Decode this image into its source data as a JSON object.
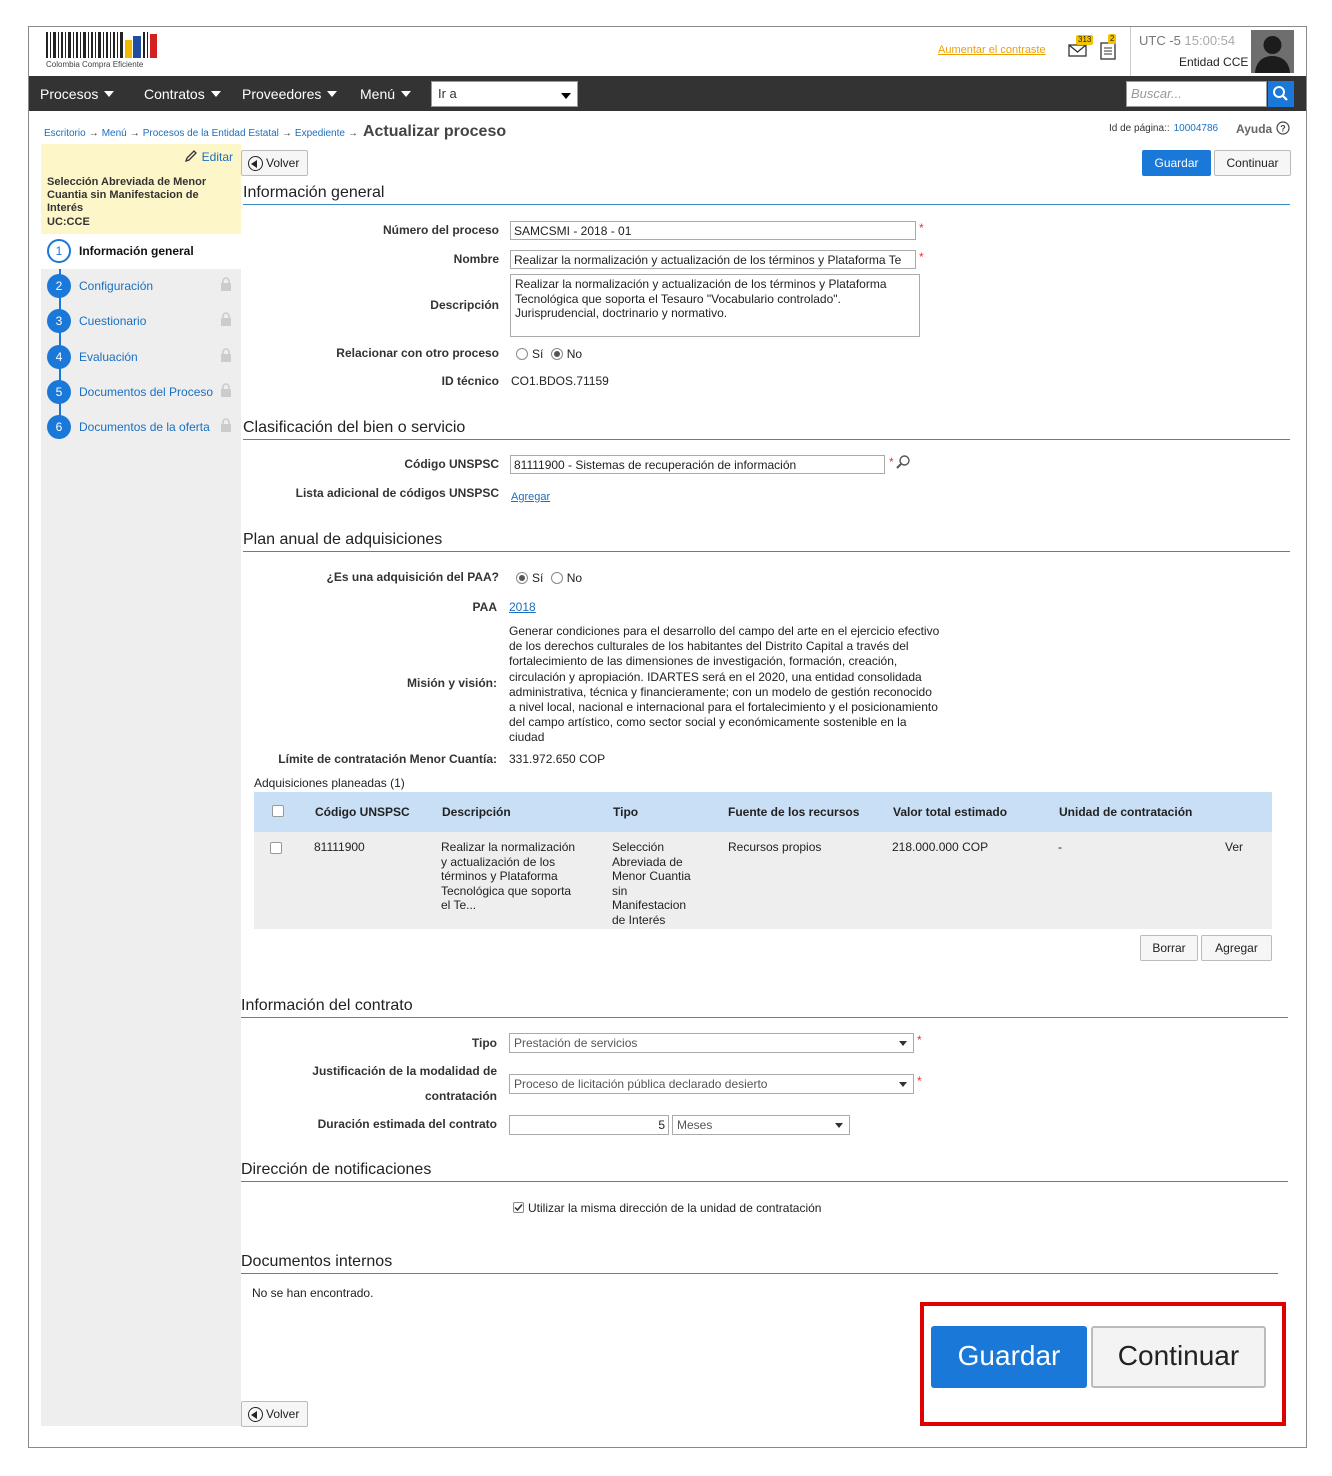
{
  "header": {
    "logo_text": "Colombia Compra Eficiente",
    "contrast_link": "Aumentar el contraste",
    "mail_count": "313",
    "notes_count": "2",
    "timezone": "UTC -5",
    "time": "15:00:54",
    "entity": "Entidad CCE"
  },
  "nav": {
    "items": [
      {
        "label": "Procesos"
      },
      {
        "label": "Contratos"
      },
      {
        "label": "Proveedores"
      },
      {
        "label": "Menú"
      }
    ],
    "goto": "Ir a",
    "search_placeholder": "Buscar..."
  },
  "breadcrumb": {
    "items": [
      "Escritorio",
      "Menú",
      "Procesos de la Entidad Estatal",
      "Expediente"
    ],
    "current": "Actualizar proceso",
    "arrow": "→"
  },
  "page_id": {
    "label": "Id de página::",
    "value": "10004786",
    "help": "Ayuda"
  },
  "sidebar": {
    "edit": "Editar",
    "process_type": "Selección Abreviada de Menor Cuantia sin Manifestacion de Interés",
    "uc": "UC:CCE",
    "steps": [
      {
        "num": "1",
        "label": "Información general"
      },
      {
        "num": "2",
        "label": "Configuración"
      },
      {
        "num": "3",
        "label": "Cuestionario"
      },
      {
        "num": "4",
        "label": "Evaluación"
      },
      {
        "num": "5",
        "label": "Documentos del Proceso"
      },
      {
        "num": "6",
        "label": "Documentos de la oferta"
      }
    ]
  },
  "buttons": {
    "back": "Volver",
    "save": "Guardar",
    "continue": "Continuar",
    "delete": "Borrar",
    "add": "Agregar"
  },
  "general": {
    "title": "Información general",
    "process_number_label": "Número del proceso",
    "process_number": "SAMCSMI - 2018 - 01",
    "name_label": "Nombre",
    "name": "Realizar la normalización y actualización de los términos y Plataforma Te",
    "description_label": "Descripción",
    "description": "Realizar la normalización y actualización de los términos y Plataforma Tecnológica que soporta el Tesauro \"Vocabulario controlado\". Jurisprudencial, doctrinario y normativo.",
    "relate_label": "Relacionar con otro proceso",
    "yes": "Sí",
    "no": "No",
    "tech_id_label": "ID técnico",
    "tech_id": "CO1.BDOS.71159",
    "required": "*"
  },
  "classification": {
    "title": "Clasificación del bien o servicio",
    "code_label": "Código UNSPSC",
    "code": "81111900 - Sistemas de recuperación de información",
    "extra_label": "Lista adicional de códigos UNSPSC",
    "add_link": "Agregar"
  },
  "paa": {
    "title": "Plan anual de adquisiciones",
    "question": "¿Es una adquisición del PAA?",
    "paa_label": "PAA",
    "paa_year": "2018",
    "mission_label": "Misión y visión:",
    "mission_lines": [
      "Generar condiciones para el desarrollo del campo del arte en el ejercicio efectivo",
      "de los derechos culturales de los habitantes del Distrito Capital a través del",
      "fortalecimiento de las dimensiones de investigación, formación, creación,",
      "circulación y apropiación. IDARTES será en el 2020, una entidad consolidada",
      "administrativa, técnica y financieramente; con un modelo de gestión reconocido",
      "a nivel local, nacional e internacional para el fortalecimiento y el posicionamiento",
      "del campo artístico, como sector social y económicamente sostenible en la",
      "ciudad"
    ],
    "limit_label": "Límite de contratación Menor Cuantía:",
    "limit_value": "331.972.650 COP",
    "planned_label": "Adquisiciones planeadas (1)",
    "table": {
      "headers": [
        "Código UNSPSC",
        "Descripción",
        "Tipo",
        "Fuente de los recursos",
        "Valor total estimado",
        "Unidad de contratación"
      ],
      "row": {
        "code": "81111900",
        "description": [
          "Realizar la normalización",
          "y actualización de los",
          "términos y Plataforma",
          "Tecnológica que soporta",
          "el Te..."
        ],
        "type": [
          "Selección",
          "Abreviada de",
          "Menor Cuantia",
          "sin",
          "Manifestacion",
          "de Interés"
        ],
        "source": "Recursos propios",
        "value": "218.000.000 COP",
        "unit": "-",
        "view": "Ver"
      }
    }
  },
  "contract": {
    "title": "Información del contrato",
    "type_label": "Tipo",
    "type": "Prestación de servicios",
    "justification_label_1": "Justificación de la modalidad de",
    "justification_label_2": "contratación",
    "justification": "Proceso de licitación pública declarado desierto",
    "duration_label": "Duración estimada del contrato",
    "duration": "5",
    "duration_unit": "Meses"
  },
  "notifications": {
    "title": "Dirección de notificaciones",
    "same_address": "Utilizar la misma dirección de la unidad de contratación"
  },
  "internal_docs": {
    "title": "Documentos internos",
    "empty": "No se han encontrado."
  }
}
